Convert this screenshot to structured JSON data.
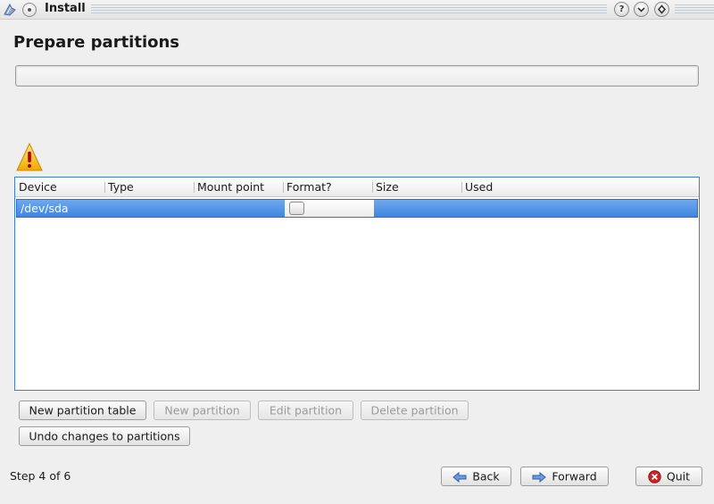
{
  "window": {
    "title": "Install",
    "help_glyph": "?",
    "minimize_glyph": "⌄",
    "maximize_glyph": "◆"
  },
  "page": {
    "title": "Prepare partitions"
  },
  "table": {
    "columns": [
      "Device",
      "Type",
      "Mount point",
      "Format?",
      "Size",
      "Used"
    ],
    "rows": [
      {
        "device": "/dev/sda",
        "type": "",
        "mount_point": "",
        "format": false,
        "size": "",
        "used": ""
      }
    ]
  },
  "buttons": {
    "new_partition_table": "New partition table",
    "new_partition": "New partition",
    "edit_partition": "Edit partition",
    "delete_partition": "Delete partition",
    "undo_changes": "Undo changes to partitions",
    "back": "Back",
    "forward": "Forward",
    "quit": "Quit"
  },
  "footer": {
    "step": "Step 4 of 6"
  },
  "colors": {
    "selection": "#3f86e0",
    "focus_border": "#3e7fd6",
    "warning": "#f2b400",
    "quit_red": "#d42020",
    "arrow_blue": "#3a6fc2"
  },
  "icons": {
    "app": "installer-icon",
    "warning": "warning-icon",
    "back": "arrow-left-icon",
    "forward": "arrow-right-icon",
    "quit": "quit-icon"
  }
}
